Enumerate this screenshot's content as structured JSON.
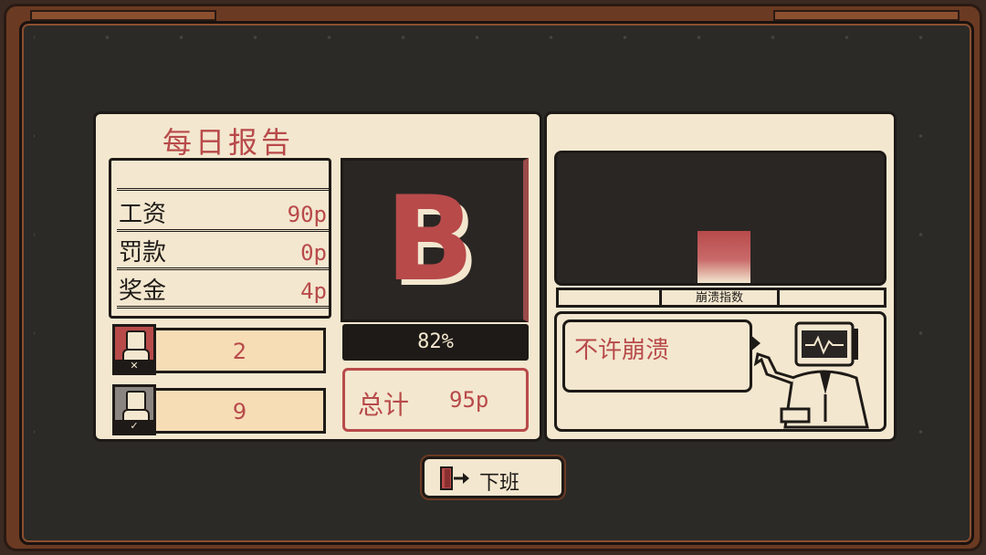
{
  "report": {
    "title": "每日报告",
    "ledger": [
      {
        "label": "工资",
        "value": "90p"
      },
      {
        "label": "罚款",
        "value": "0p"
      },
      {
        "label": "奖金",
        "value": "4p"
      }
    ],
    "workers": [
      {
        "avatar": "sad-worker-icon",
        "count": "2",
        "status_icon": "cross-icon",
        "color": "#b84a4a"
      },
      {
        "avatar": "happy-worker-icon",
        "count": "9",
        "status_icon": "check-icon",
        "color": "#8a8580"
      }
    ],
    "grade": "B",
    "progress": {
      "value": 82,
      "label": "82%"
    },
    "total": {
      "label": "总计",
      "value": "95p"
    }
  },
  "collapse": {
    "index_label": "崩溃指数",
    "level": 0.4,
    "message": "不许崩溃"
  },
  "actions": {
    "off_work_label": "下班"
  },
  "colors": {
    "accent": "#b84a4a",
    "paper": "#f3e7cf",
    "ink": "#1e1a17",
    "frame": "#6b3a22"
  }
}
